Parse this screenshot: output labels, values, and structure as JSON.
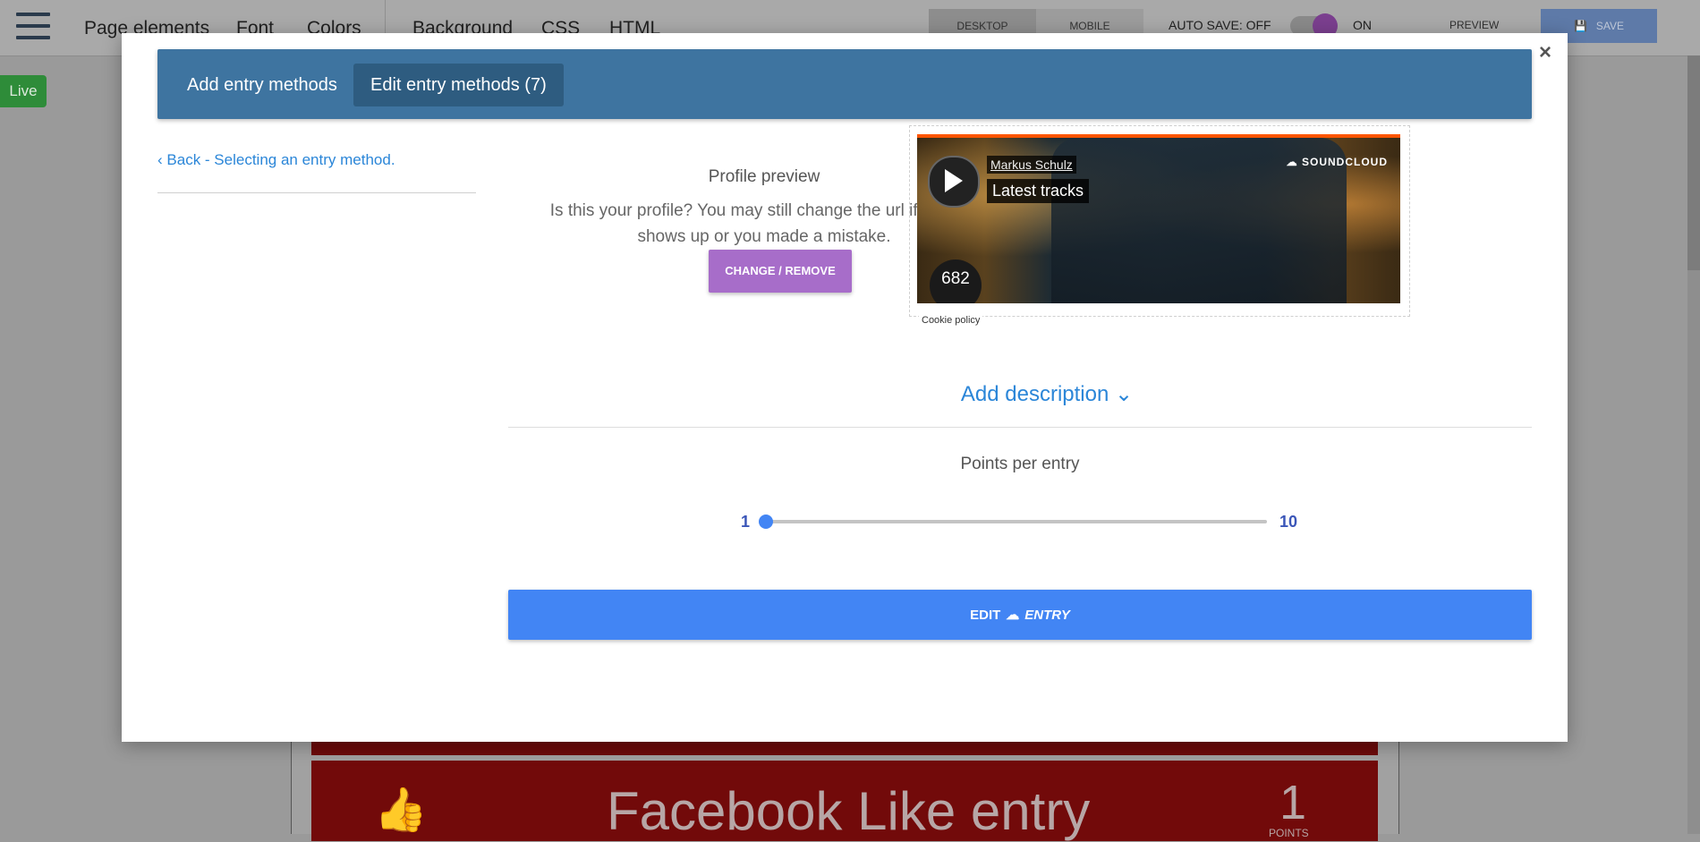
{
  "topbar": {
    "nav": [
      "Page elements",
      "Font",
      "Colors",
      "Background",
      "CSS",
      "HTML"
    ],
    "device_tabs": [
      "DESKTOP",
      "MOBILE"
    ],
    "autosave_label": "AUTO SAVE: OFF",
    "on_label": "ON",
    "preview_label": "PREVIEW",
    "save_label": "SAVE"
  },
  "live_badge": "Live",
  "background_entry": {
    "title": "Facebook Like entry",
    "points": "1",
    "points_label": "POINTS"
  },
  "modal": {
    "close": "×",
    "tabs": [
      "Add entry methods",
      "Edit entry methods (7)"
    ],
    "active_tab": 1,
    "back_link": "Back - Selecting an entry method.",
    "profile_title": "Profile preview",
    "profile_desc": "Is this your profile? You may still change the url if nothing shows up or you made a mistake.",
    "change_button": "CHANGE / REMOVE",
    "embed": {
      "artist": "Markus Schulz",
      "title": "Latest tracks",
      "brand": "SOUNDCLOUD",
      "count": "682",
      "cookie": "Cookie policy"
    },
    "add_description": "Add description",
    "points_title": "Points per entry",
    "slider": {
      "min": "1",
      "max": "10",
      "value": 1
    },
    "edit_button": {
      "pre": "EDIT",
      "post": "ENTRY"
    }
  },
  "colors": {
    "header": "#3e74a0",
    "accent": "#4285f4",
    "purple": "#a76dc9",
    "link": "#2b86d8",
    "soundcloud": "#ff5500"
  }
}
